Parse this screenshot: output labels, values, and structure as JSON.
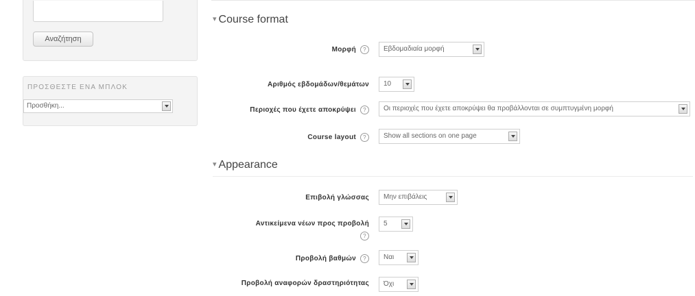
{
  "search_block": {
    "button_label": "Αναζήτηση"
  },
  "add_block": {
    "title": "ΠΡΟΣΘΕΣΤΕ ΕΝΑ ΜΠΛΟΚ",
    "select_value": "Προσθήκη..."
  },
  "course_format": {
    "header": "Course format",
    "fields": [
      {
        "label": "Μορφή",
        "value": "Εβδομαδιαία μορφή",
        "help": true
      },
      {
        "label": "Αριθμός εβδομάδων/θεμάτων",
        "value": "10",
        "help": false
      },
      {
        "label": "Περιοχές που έχετε αποκρύψει",
        "value": "Οι περιοχές που έχετε αποκρύψει θα προβάλλονται σε συμπτυγμένη μορφή",
        "help": true
      },
      {
        "label": "Course layout",
        "value": "Show all sections on one page",
        "help": true
      }
    ]
  },
  "appearance": {
    "header": "Appearance",
    "fields": [
      {
        "label": "Επιβολή γλώσσας",
        "value": "Μην επιβάλεις",
        "help": false
      },
      {
        "label": "Αντικείμενα νέων προς προβολή",
        "value": "5",
        "help": true
      },
      {
        "label": "Προβολή βαθμών",
        "value": "Ναι",
        "help": true
      },
      {
        "label": "Προβολή αναφορών δραστηριότητας",
        "value": "Όχι",
        "help": false
      }
    ]
  },
  "help_icon_glyph": "?",
  "section_toggle_glyph": "▾"
}
